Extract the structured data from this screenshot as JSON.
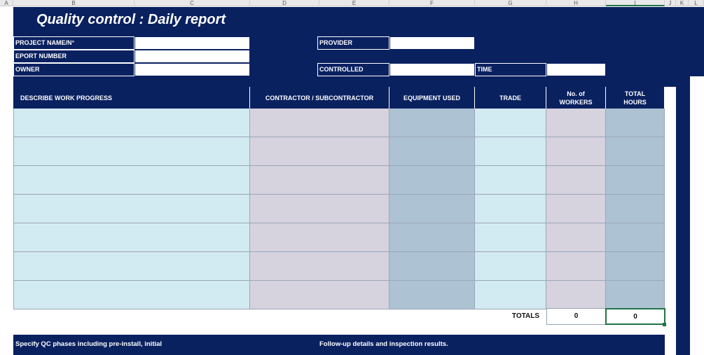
{
  "spreadsheet": {
    "columns": [
      {
        "id": "A",
        "selected": false
      },
      {
        "id": "B",
        "selected": false
      },
      {
        "id": "C",
        "selected": false
      },
      {
        "id": "D",
        "selected": false
      },
      {
        "id": "E",
        "selected": false
      },
      {
        "id": "F",
        "selected": false
      },
      {
        "id": "G",
        "selected": false
      },
      {
        "id": "H",
        "selected": false
      },
      {
        "id": "I",
        "selected": true
      },
      {
        "id": "J",
        "selected": false
      },
      {
        "id": "K",
        "selected": false
      },
      {
        "id": "L",
        "selected": false
      }
    ]
  },
  "report": {
    "title": "Quality control : Daily report",
    "fields": {
      "project_name_label": "PROJECT NAME/N°",
      "report_number_label": "EPORT NUMBER",
      "owner_label": "OWNER",
      "provider_label": "PROVIDER",
      "controlled_label": "CONTROLLED",
      "time_label": "TIME",
      "project_name_value": "",
      "report_number_value": "",
      "owner_value": "",
      "provider_value": "",
      "controlled_value": "",
      "time_value": ""
    },
    "table": {
      "headers": {
        "describe": "DESCRIBE WORK PROGRESS",
        "contractor": "CONTRACTOR / SUBCONTRACTOR",
        "equipment": "EQUIPMENT USED",
        "trade": "TRADE",
        "workers": "No. of WORKERS",
        "hours": "TOTAL HOURS"
      },
      "row_count": 7,
      "totals_label": "TOTALS",
      "total_workers": "0",
      "total_hours": "0"
    },
    "footer": {
      "left": "Specify QC phases including pre-install, initial",
      "right": "Follow-up details and inspection results."
    }
  },
  "colors": {
    "navy": "#0a2160",
    "light_blue": "#d2eaf1",
    "lavender": "#d6d3de",
    "steel_blue": "#adc3d4",
    "selection_green": "#217346"
  }
}
